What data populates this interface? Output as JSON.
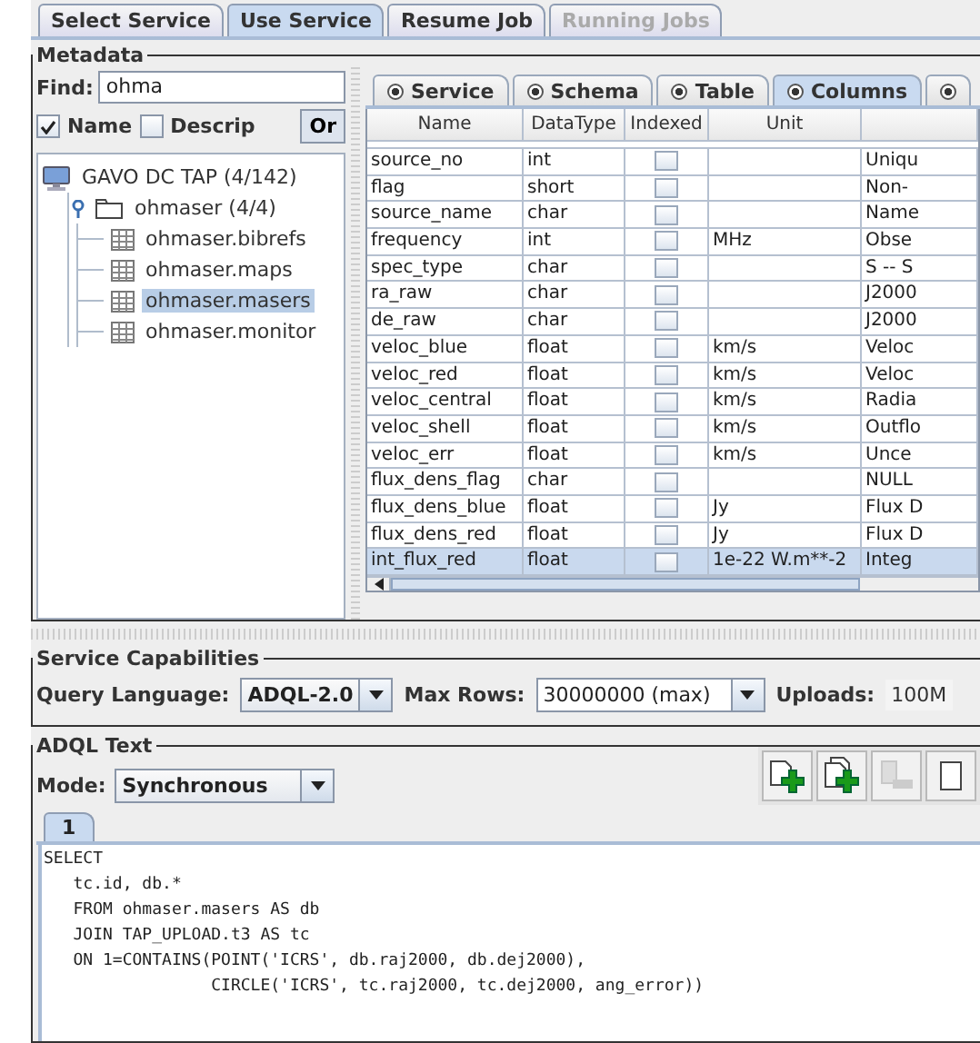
{
  "top_tabs": [
    {
      "label": "Select Service",
      "selected": false,
      "disabled": false
    },
    {
      "label": "Use Service",
      "selected": true,
      "disabled": false
    },
    {
      "label": "Resume Job",
      "selected": false,
      "disabled": false
    },
    {
      "label": "Running Jobs",
      "selected": false,
      "disabled": true
    }
  ],
  "metadata": {
    "title": "Metadata",
    "find_label": "Find:",
    "find_value": "ohma",
    "filters": [
      {
        "label": "Name",
        "checked": true
      },
      {
        "label": "Descrip",
        "checked": false
      }
    ],
    "or_button": "Or",
    "tree": [
      {
        "label": "GAVO DC TAP (4/142)",
        "kind": "service",
        "children": [
          {
            "label": "ohmaser (4/4)",
            "kind": "schema",
            "expanded": true,
            "children": [
              {
                "label": "ohmaser.bibrefs",
                "kind": "table",
                "selected": false
              },
              {
                "label": "ohmaser.maps",
                "kind": "table",
                "selected": false
              },
              {
                "label": "ohmaser.masers",
                "kind": "table",
                "selected": true
              },
              {
                "label": "ohmaser.monitor",
                "kind": "table",
                "selected": false
              }
            ]
          }
        ]
      }
    ],
    "detail_tabs": [
      {
        "label": "Service",
        "selected": false
      },
      {
        "label": "Schema",
        "selected": false
      },
      {
        "label": "Table",
        "selected": false
      },
      {
        "label": "Columns",
        "selected": true
      },
      {
        "selected": false
      }
    ],
    "table": {
      "columns": [
        "Name",
        "DataType",
        "Indexed",
        "Unit"
      ],
      "rows": [
        {
          "name": "source_no",
          "datatype": "int",
          "indexed": false,
          "column_5": "Uniqu",
          "selected": false
        },
        {
          "name": "flag",
          "datatype": "short",
          "indexed": false,
          "column_5": "Non-",
          "selected": false
        },
        {
          "name": "source_name",
          "datatype": "char",
          "indexed": false,
          "column_5": "Name",
          "selected": false
        },
        {
          "name": "frequency",
          "datatype": "int",
          "indexed": false,
          "unit": "MHz",
          "column_5": "Obse",
          "selected": false
        },
        {
          "name": "spec_type",
          "datatype": "char",
          "indexed": false,
          "column_5": "S -- S",
          "selected": false
        },
        {
          "name": "ra_raw",
          "datatype": "char",
          "indexed": false,
          "column_5": "J2000",
          "selected": false
        },
        {
          "name": "de_raw",
          "datatype": "char",
          "indexed": false,
          "column_5": "J2000",
          "selected": false
        },
        {
          "name": "veloc_blue",
          "datatype": "float",
          "indexed": false,
          "unit": "km/s",
          "column_5": "Veloc",
          "selected": false
        },
        {
          "name": "veloc_red",
          "datatype": "float",
          "indexed": false,
          "unit": "km/s",
          "column_5": "Veloc",
          "selected": false
        },
        {
          "name": "veloc_central",
          "datatype": "float",
          "indexed": false,
          "unit": "km/s",
          "column_5": "Radia",
          "selected": false
        },
        {
          "name": "veloc_shell",
          "datatype": "float",
          "indexed": false,
          "unit": "km/s",
          "column_5": "Outflo",
          "selected": false
        },
        {
          "name": "veloc_err",
          "datatype": "float",
          "indexed": false,
          "unit": "km/s",
          "column_5": "Unce",
          "selected": false
        },
        {
          "name": "flux_dens_flag",
          "datatype": "char",
          "indexed": false,
          "column_5": "NULL",
          "selected": false
        },
        {
          "name": "flux_dens_blue",
          "datatype": "float",
          "indexed": false,
          "unit": "Jy",
          "column_5": "Flux D",
          "selected": false
        },
        {
          "name": "flux_dens_red",
          "datatype": "float",
          "indexed": false,
          "unit": "Jy",
          "column_5": "Flux D",
          "selected": false
        },
        {
          "name": "int_flux_red",
          "datatype": "float",
          "indexed": false,
          "unit": "1e-22 W.m**-2",
          "column_5": "Integ",
          "selected": true
        }
      ]
    }
  },
  "capabilities": {
    "title": "Service Capabilities",
    "fields": [
      {
        "label": "Query Language:",
        "value": "ADQL-2.0",
        "kind": "dropdown"
      },
      {
        "label": "Max Rows:",
        "value": "30000000 (max)",
        "kind": "combo"
      },
      {
        "label": "Uploads:",
        "value": "100M",
        "kind": "text"
      }
    ]
  },
  "adql": {
    "title": "ADQL Text",
    "mode_label": "Mode:",
    "mode_value": "Synchronous",
    "toolbar": [
      {
        "kind": "add-file",
        "disabled": false
      },
      {
        "kind": "add-files",
        "disabled": false
      },
      {
        "kind": "remove",
        "disabled": true
      },
      {
        "kind": "partial",
        "disabled": false
      }
    ],
    "editor_tabs": [
      {
        "label": "1",
        "selected": true
      }
    ],
    "query": "SELECT\n   tc.id, db.*\n   FROM ohmaser.masers AS db\n   JOIN TAP_UPLOAD.t3 AS tc\n   ON 1=CONTAINS(POINT('ICRS', db.raj2000, db.dej2000),\n                 CIRCLE('ICRS', tc.raj2000, tc.dej2000, ang_error))"
  }
}
